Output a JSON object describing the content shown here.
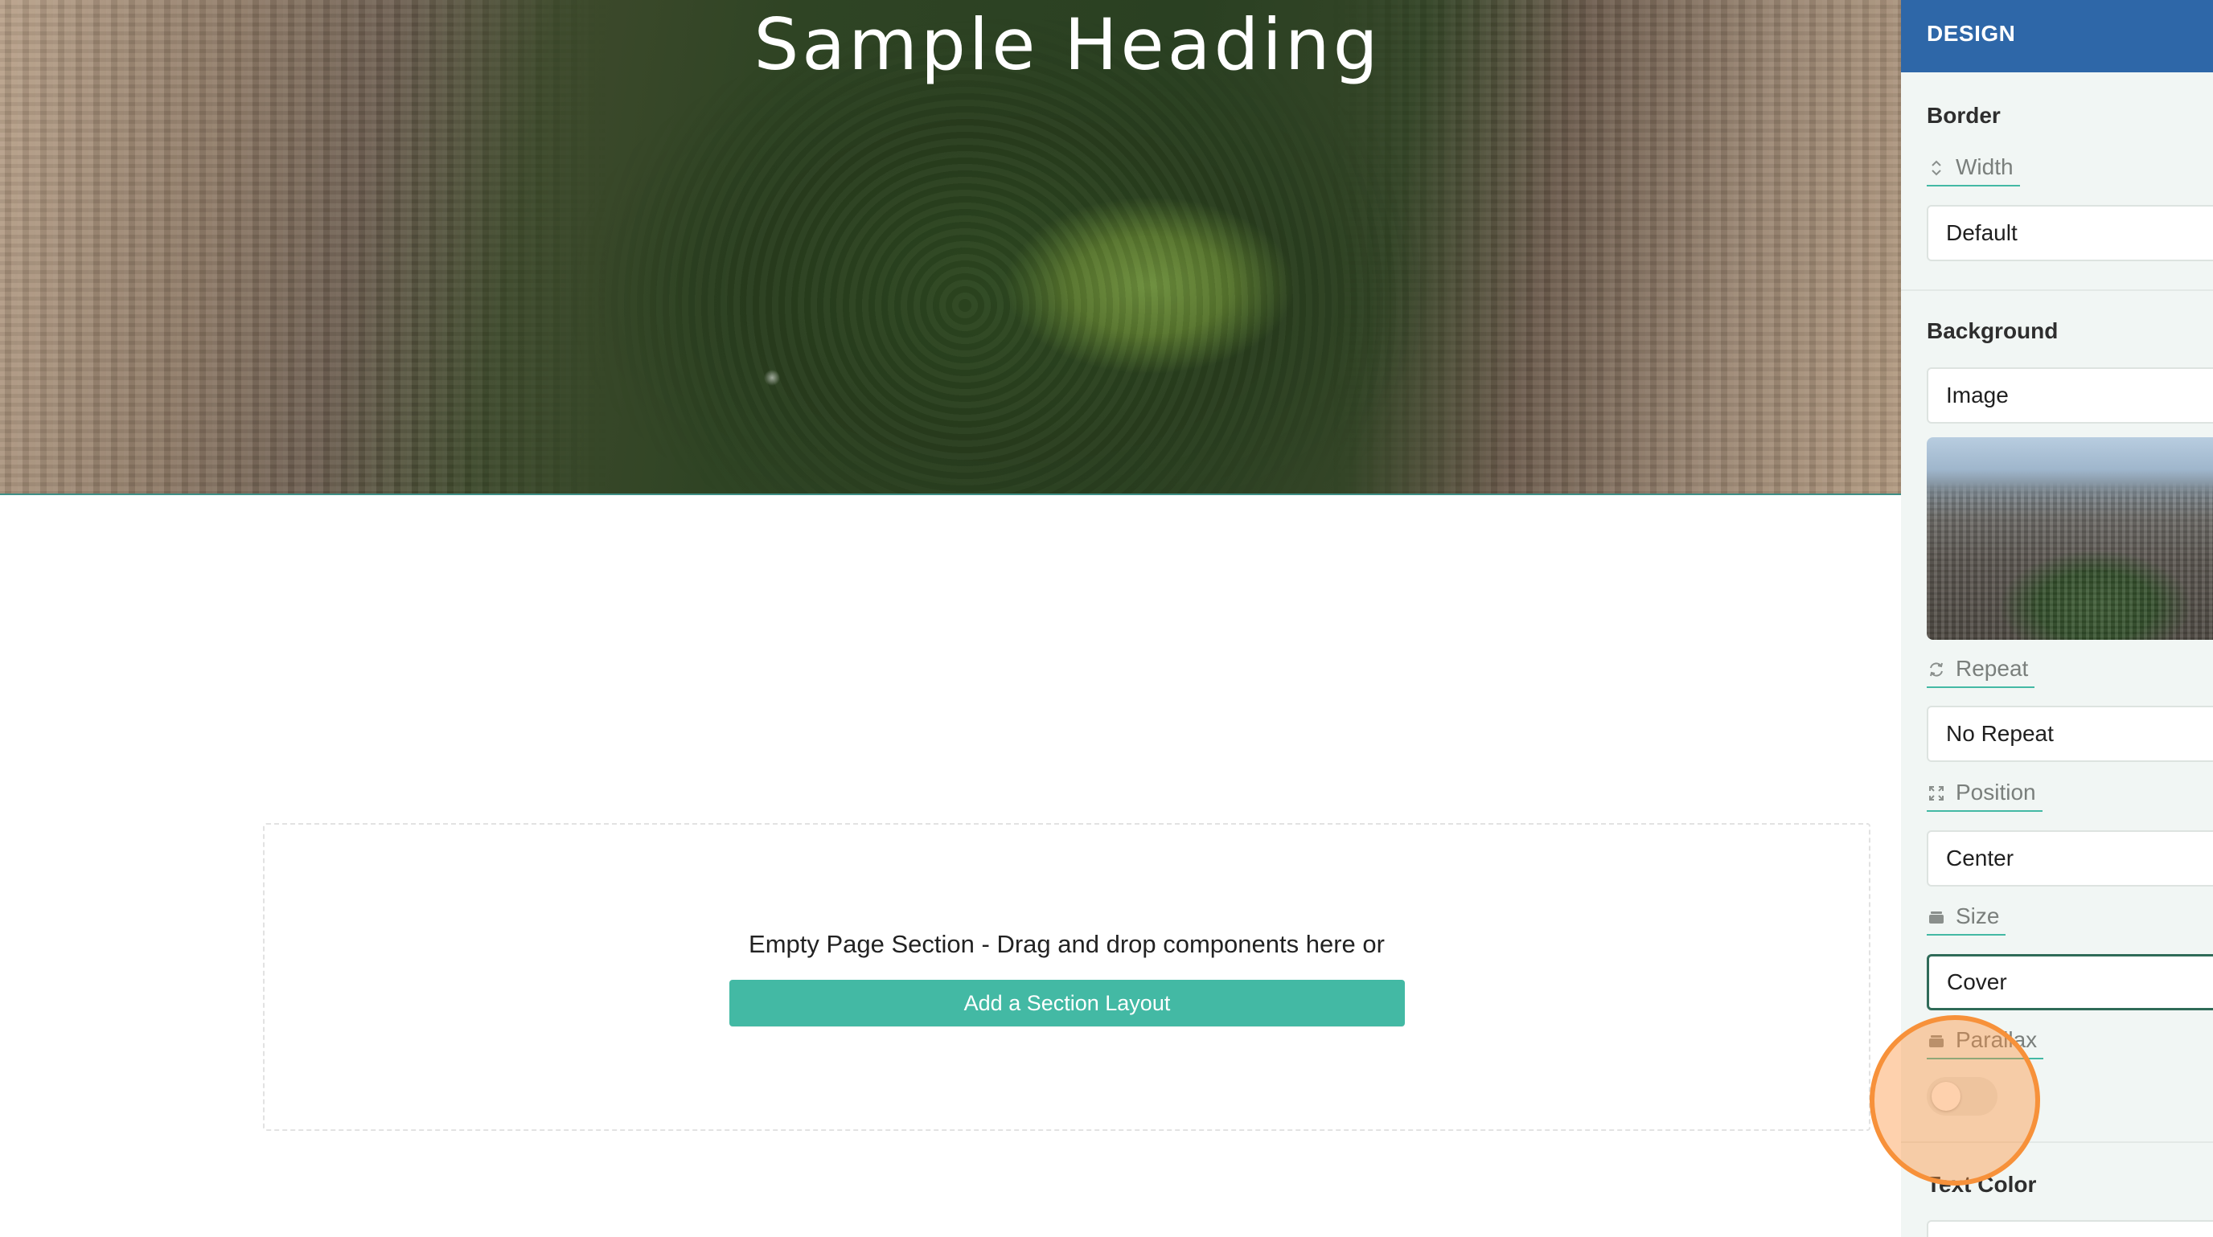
{
  "hero": {
    "heading": "Sample Heading"
  },
  "empty_section": {
    "message": "Empty Page Section - Drag and drop components here or",
    "add_button": "Add a Section Layout"
  },
  "panel": {
    "header": "DESIGN",
    "border": {
      "title": "Border",
      "width_label": "Width",
      "width_icon": "up-down-chevron-icon",
      "width_value": "Default"
    },
    "background": {
      "title": "Background",
      "type_value": "Image",
      "repeat_label": "Repeat",
      "repeat_icon": "repeat-icon",
      "repeat_value": "No Repeat",
      "position_label": "Position",
      "position_icon": "expand-icon",
      "position_value": "Center",
      "size_label": "Size",
      "size_icon": "stack-icon",
      "size_value": "Cover",
      "parallax_label": "Parallax",
      "parallax_icon": "stack-icon",
      "parallax_on": false
    },
    "text_color": {
      "title": "Text Color"
    }
  },
  "colors": {
    "accent": "#43b9a4",
    "panel_header": "#2e67a8",
    "click_highlight": "#f7913a"
  }
}
